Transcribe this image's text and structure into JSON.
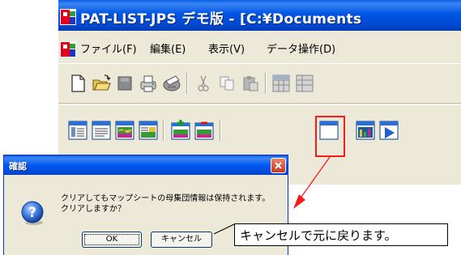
{
  "window": {
    "title": "PAT-LIST-JPS デモ版 - [C:¥Documents"
  },
  "menu": {
    "items": [
      "ファイル(F)",
      "編集(E)",
      "表示(V)",
      "データ操作(D)"
    ]
  },
  "toolbar1": {
    "buttons": [
      "new-file-icon",
      "open-folder-icon",
      "save-icon",
      "print-icon",
      "print-setup-icon",
      "cut-icon",
      "copy-icon",
      "paste-icon",
      "grid-icon",
      "grid-2-icon"
    ]
  },
  "toolbar2": {
    "buttons": [
      "list-view-icon",
      "text-view-icon",
      "map-icon",
      "map-text-icon",
      "map-add-icon",
      "map-remove-icon",
      "blank-window-icon",
      "chart-icon",
      "play-icon"
    ]
  },
  "dialog": {
    "title": "確認",
    "message_line1": "クリアしてもマップシートの母集団情報は保持されます。",
    "message_line2": "クリアしますか？",
    "ok_label": "OK",
    "cancel_label": "キャンセル"
  },
  "annotation": {
    "callout_text": "キャンセルで元に戻ります。",
    "color": "#ff1a1a"
  },
  "colors": {
    "titlebar": "#0054e3",
    "window_bg": "#ece9d8"
  }
}
